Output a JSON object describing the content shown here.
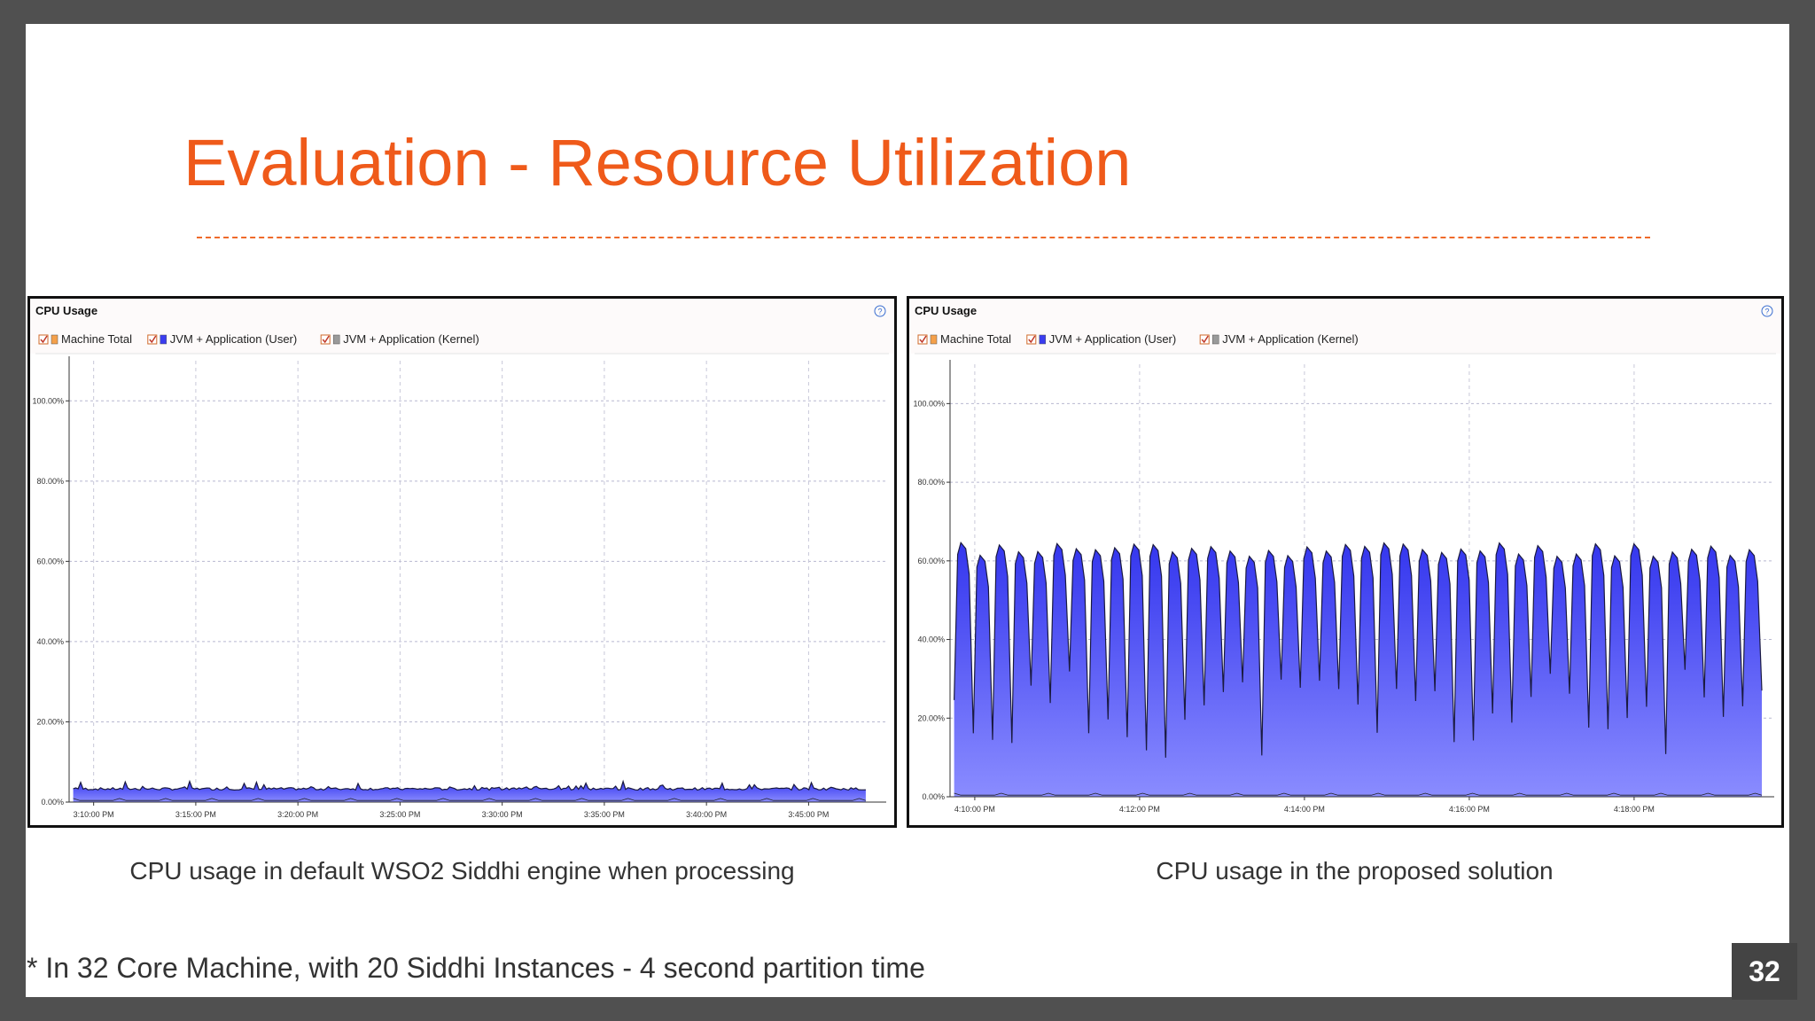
{
  "slide": {
    "title": "Evaluation - Resource Utilization",
    "page_number": "32",
    "footnote": "* In 32 Core Machine, with 20 Siddhi Instances - 4 second partition time"
  },
  "colors": {
    "title": "#ef5a1a",
    "machine_total": "#f5a04a",
    "jvm_user": "#3a3cf0",
    "jvm_kernel": "#9a9a9a"
  },
  "icons": {
    "help": "help-circle-icon",
    "checkbox": "checkbox-checked-icon"
  },
  "chart_data": [
    {
      "type": "area",
      "panel_title": "CPU Usage",
      "legend": [
        "Machine Total",
        "JVM + Application (User)",
        "JVM + Application (Kernel)"
      ],
      "legend_placement": "top-left",
      "grid": true,
      "ylim": [
        0,
        110
      ],
      "yticks": [
        0,
        20,
        40,
        60,
        80,
        100
      ],
      "ytick_labels": [
        "0.00%",
        "20.00%",
        "40.00%",
        "60.00%",
        "80.00%",
        "100.00%"
      ],
      "xlim": [
        0,
        40
      ],
      "xticks": [
        1.2,
        6.2,
        11.2,
        16.2,
        21.2,
        26.2,
        31.2,
        36.2
      ],
      "xtick_labels": [
        "3:10:00 PM",
        "3:15:00 PM",
        "3:20:00 PM",
        "3:25:00 PM",
        "3:30:00 PM",
        "3:35:00 PM",
        "3:40:00 PM",
        "3:45:00 PM"
      ],
      "series": [
        {
          "name": "JVM + Application (User)",
          "baseline_percent": 3,
          "pattern": "flat",
          "description": "constant near 3%"
        }
      ],
      "caption": "CPU usage in default WSO2 Siddhi engine when processing"
    },
    {
      "type": "area",
      "panel_title": "CPU Usage",
      "legend": [
        "Machine Total",
        "JVM + Application (User)",
        "JVM + Application (Kernel)"
      ],
      "legend_placement": "top-left",
      "grid": true,
      "ylim": [
        0,
        110
      ],
      "yticks": [
        0,
        20,
        40,
        60,
        80,
        100
      ],
      "ytick_labels": [
        "0.00%",
        "20.00%",
        "40.00%",
        "60.00%",
        "80.00%",
        "100.00%"
      ],
      "xlim": [
        0,
        10
      ],
      "xticks": [
        0.3,
        2.3,
        4.3,
        6.3,
        8.3
      ],
      "xtick_labels": [
        "4:10:00 PM",
        "4:12:00 PM",
        "4:14:00 PM",
        "4:16:00 PM",
        "4:18:00 PM"
      ],
      "series": [
        {
          "name": "JVM + Application (User)",
          "peak_percent": 64,
          "dip_percent": 15,
          "cycles": 42,
          "pattern": "oscillating"
        }
      ],
      "caption": "CPU usage in the proposed solution"
    }
  ]
}
